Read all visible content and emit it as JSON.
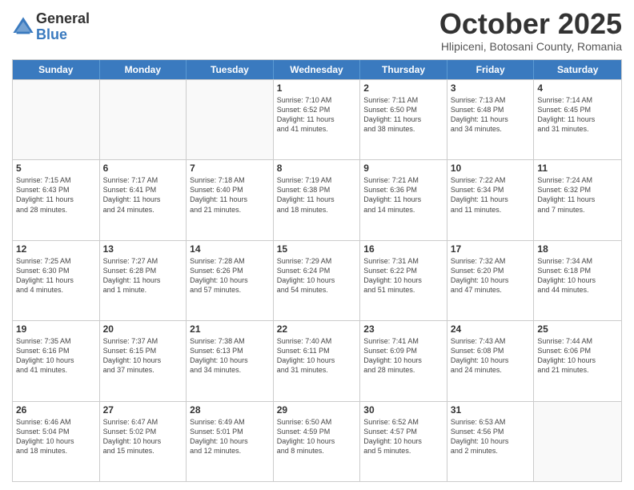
{
  "logo": {
    "general": "General",
    "blue": "Blue"
  },
  "title": "October 2025",
  "location": "Hlipiceni, Botosani County, Romania",
  "days_header": [
    "Sunday",
    "Monday",
    "Tuesday",
    "Wednesday",
    "Thursday",
    "Friday",
    "Saturday"
  ],
  "weeks": [
    [
      {
        "num": "",
        "info": ""
      },
      {
        "num": "",
        "info": ""
      },
      {
        "num": "",
        "info": ""
      },
      {
        "num": "1",
        "info": "Sunrise: 7:10 AM\nSunset: 6:52 PM\nDaylight: 11 hours\nand 41 minutes."
      },
      {
        "num": "2",
        "info": "Sunrise: 7:11 AM\nSunset: 6:50 PM\nDaylight: 11 hours\nand 38 minutes."
      },
      {
        "num": "3",
        "info": "Sunrise: 7:13 AM\nSunset: 6:48 PM\nDaylight: 11 hours\nand 34 minutes."
      },
      {
        "num": "4",
        "info": "Sunrise: 7:14 AM\nSunset: 6:45 PM\nDaylight: 11 hours\nand 31 minutes."
      }
    ],
    [
      {
        "num": "5",
        "info": "Sunrise: 7:15 AM\nSunset: 6:43 PM\nDaylight: 11 hours\nand 28 minutes."
      },
      {
        "num": "6",
        "info": "Sunrise: 7:17 AM\nSunset: 6:41 PM\nDaylight: 11 hours\nand 24 minutes."
      },
      {
        "num": "7",
        "info": "Sunrise: 7:18 AM\nSunset: 6:40 PM\nDaylight: 11 hours\nand 21 minutes."
      },
      {
        "num": "8",
        "info": "Sunrise: 7:19 AM\nSunset: 6:38 PM\nDaylight: 11 hours\nand 18 minutes."
      },
      {
        "num": "9",
        "info": "Sunrise: 7:21 AM\nSunset: 6:36 PM\nDaylight: 11 hours\nand 14 minutes."
      },
      {
        "num": "10",
        "info": "Sunrise: 7:22 AM\nSunset: 6:34 PM\nDaylight: 11 hours\nand 11 minutes."
      },
      {
        "num": "11",
        "info": "Sunrise: 7:24 AM\nSunset: 6:32 PM\nDaylight: 11 hours\nand 7 minutes."
      }
    ],
    [
      {
        "num": "12",
        "info": "Sunrise: 7:25 AM\nSunset: 6:30 PM\nDaylight: 11 hours\nand 4 minutes."
      },
      {
        "num": "13",
        "info": "Sunrise: 7:27 AM\nSunset: 6:28 PM\nDaylight: 11 hours\nand 1 minute."
      },
      {
        "num": "14",
        "info": "Sunrise: 7:28 AM\nSunset: 6:26 PM\nDaylight: 10 hours\nand 57 minutes."
      },
      {
        "num": "15",
        "info": "Sunrise: 7:29 AM\nSunset: 6:24 PM\nDaylight: 10 hours\nand 54 minutes."
      },
      {
        "num": "16",
        "info": "Sunrise: 7:31 AM\nSunset: 6:22 PM\nDaylight: 10 hours\nand 51 minutes."
      },
      {
        "num": "17",
        "info": "Sunrise: 7:32 AM\nSunset: 6:20 PM\nDaylight: 10 hours\nand 47 minutes."
      },
      {
        "num": "18",
        "info": "Sunrise: 7:34 AM\nSunset: 6:18 PM\nDaylight: 10 hours\nand 44 minutes."
      }
    ],
    [
      {
        "num": "19",
        "info": "Sunrise: 7:35 AM\nSunset: 6:16 PM\nDaylight: 10 hours\nand 41 minutes."
      },
      {
        "num": "20",
        "info": "Sunrise: 7:37 AM\nSunset: 6:15 PM\nDaylight: 10 hours\nand 37 minutes."
      },
      {
        "num": "21",
        "info": "Sunrise: 7:38 AM\nSunset: 6:13 PM\nDaylight: 10 hours\nand 34 minutes."
      },
      {
        "num": "22",
        "info": "Sunrise: 7:40 AM\nSunset: 6:11 PM\nDaylight: 10 hours\nand 31 minutes."
      },
      {
        "num": "23",
        "info": "Sunrise: 7:41 AM\nSunset: 6:09 PM\nDaylight: 10 hours\nand 28 minutes."
      },
      {
        "num": "24",
        "info": "Sunrise: 7:43 AM\nSunset: 6:08 PM\nDaylight: 10 hours\nand 24 minutes."
      },
      {
        "num": "25",
        "info": "Sunrise: 7:44 AM\nSunset: 6:06 PM\nDaylight: 10 hours\nand 21 minutes."
      }
    ],
    [
      {
        "num": "26",
        "info": "Sunrise: 6:46 AM\nSunset: 5:04 PM\nDaylight: 10 hours\nand 18 minutes."
      },
      {
        "num": "27",
        "info": "Sunrise: 6:47 AM\nSunset: 5:02 PM\nDaylight: 10 hours\nand 15 minutes."
      },
      {
        "num": "28",
        "info": "Sunrise: 6:49 AM\nSunset: 5:01 PM\nDaylight: 10 hours\nand 12 minutes."
      },
      {
        "num": "29",
        "info": "Sunrise: 6:50 AM\nSunset: 4:59 PM\nDaylight: 10 hours\nand 8 minutes."
      },
      {
        "num": "30",
        "info": "Sunrise: 6:52 AM\nSunset: 4:57 PM\nDaylight: 10 hours\nand 5 minutes."
      },
      {
        "num": "31",
        "info": "Sunrise: 6:53 AM\nSunset: 4:56 PM\nDaylight: 10 hours\nand 2 minutes."
      },
      {
        "num": "",
        "info": ""
      }
    ]
  ]
}
